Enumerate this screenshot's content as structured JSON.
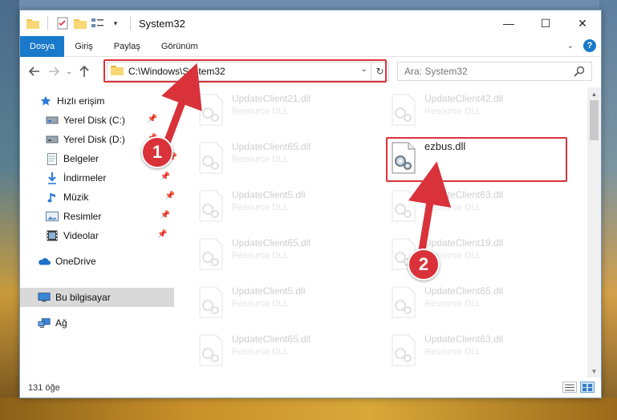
{
  "window": {
    "title": "System32",
    "controls": {
      "minimize": "—",
      "maximize": "☐",
      "close": "✕"
    }
  },
  "ribbon": {
    "tabs": [
      "Dosya",
      "Giriş",
      "Paylaş",
      "Görünüm"
    ],
    "help": "?"
  },
  "address": {
    "path": "C:\\Windows\\System32",
    "search_placeholder": "Ara: System32"
  },
  "sidebar": {
    "quick_access": "Hızlı erişim",
    "items": [
      {
        "label": "Yerel Disk (C:)",
        "icon": "drive-icon",
        "pinned": true
      },
      {
        "label": "Yerel Disk (D:)",
        "icon": "drive-icon",
        "pinned": true
      },
      {
        "label": "Belgeler",
        "icon": "document-icon",
        "pinned": true
      },
      {
        "label": "İndirmeler",
        "icon": "download-icon",
        "pinned": true
      },
      {
        "label": "Müzik",
        "icon": "music-icon",
        "pinned": true
      },
      {
        "label": "Resimler",
        "icon": "picture-icon",
        "pinned": true
      },
      {
        "label": "Videolar",
        "icon": "video-icon",
        "pinned": true
      }
    ],
    "onedrive": "OneDrive",
    "this_pc": "Bu bilgisayar",
    "network": "Ağ"
  },
  "files": {
    "left_column": [
      {
        "name": "UpdateClient21.dll",
        "type": "Resource DLL"
      },
      {
        "name": "UpdateClient65.dll",
        "type": "Resource DLL"
      },
      {
        "name": "UpdateClient5.dll",
        "type": "Resource DLL"
      },
      {
        "name": "UpdateClient65.dll",
        "type": "Resource DLL"
      },
      {
        "name": "UpdateClient5.dll",
        "type": "Resource DLL"
      },
      {
        "name": "UpdateClient65.dll",
        "type": "Resource DLL"
      }
    ],
    "right_column": [
      {
        "name": "UpdateClient42.dll",
        "type": "Resource DLL"
      },
      {
        "name": "ezbus.dll",
        "type": ""
      },
      {
        "name": "UpdateClient63.dll",
        "type": "Resource DLL"
      },
      {
        "name": "UpdateClient19.dll",
        "type": "Resource DLL"
      },
      {
        "name": "UpdateClient65.dll",
        "type": "Resource DLL"
      },
      {
        "name": "UpdateClient63.dll",
        "type": "Resource DLL"
      }
    ]
  },
  "status": {
    "item_count": "131 öğe"
  },
  "annotations": {
    "step1": "1",
    "step2": "2",
    "color": "#d9323a"
  },
  "colors": {
    "accent": "#1979ca",
    "selection": "#d9d9d9"
  }
}
